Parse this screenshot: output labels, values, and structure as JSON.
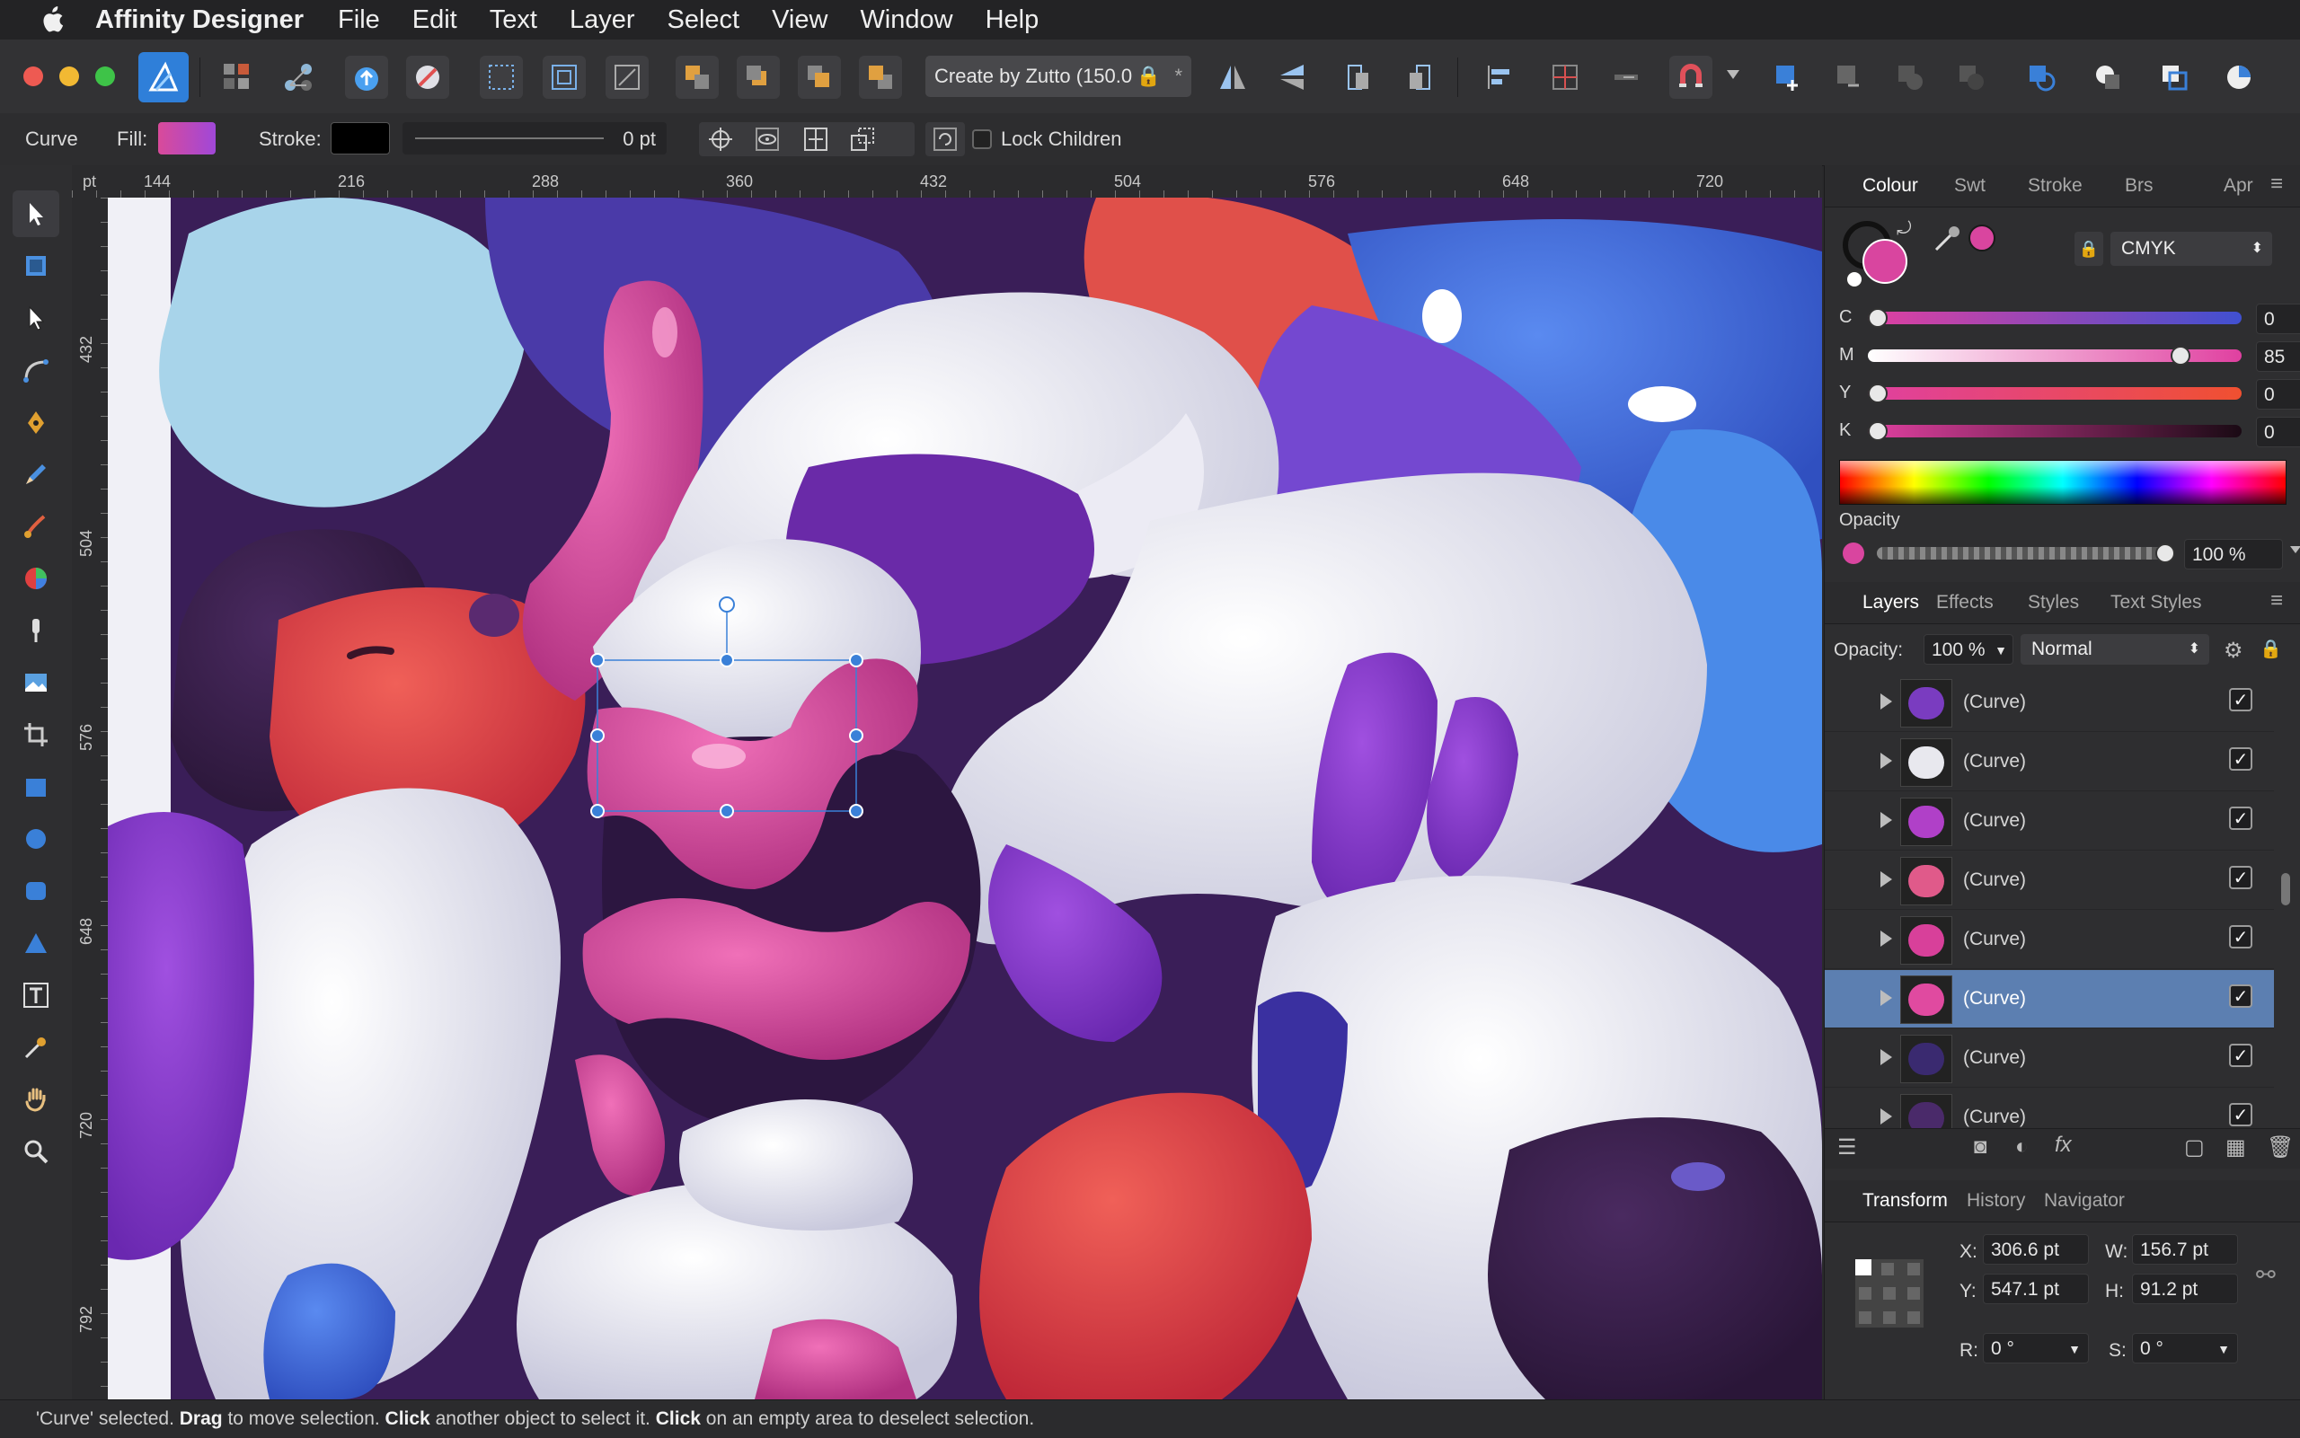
{
  "menubar": {
    "app_name": "Affinity Designer",
    "items": [
      "File",
      "Edit",
      "Text",
      "Layer",
      "Select",
      "View",
      "Window",
      "Help"
    ]
  },
  "toolbar": {
    "document_name": "Create by Zutto (150.0",
    "document_suffix": "*"
  },
  "context": {
    "object_type": "Curve",
    "fill_label": "Fill:",
    "stroke_label": "Stroke:",
    "stroke_width": "0 pt",
    "lock_children_label": "Lock Children"
  },
  "rulers": {
    "unit": "pt",
    "top_ticks": [
      "144",
      "216",
      "288",
      "360",
      "432",
      "504",
      "576",
      "648",
      "720"
    ],
    "left_ticks": [
      "432",
      "504",
      "576",
      "648",
      "720",
      "792"
    ]
  },
  "colour_panel": {
    "tabs": [
      "Colour",
      "Swt",
      "Stroke",
      "Brs",
      "Apr"
    ],
    "active_tab": "Colour",
    "mode": "CMYK",
    "channels": [
      {
        "label": "C",
        "value": "0",
        "level": 0
      },
      {
        "label": "M",
        "value": "85",
        "level": 0.85
      },
      {
        "label": "Y",
        "value": "0",
        "level": 0
      },
      {
        "label": "K",
        "value": "0",
        "level": 0
      }
    ],
    "opacity_label": "Opacity",
    "opacity_value": "100 %",
    "fill_color": "#d9459f"
  },
  "layers_panel": {
    "tabs": [
      "Layers",
      "Effects",
      "Styles",
      "Text Styles"
    ],
    "active_tab": "Layers",
    "opacity_label": "Opacity:",
    "opacity_value": "100 %",
    "blend_mode": "Normal",
    "rows": [
      {
        "name": "(Curve)",
        "selected": false,
        "visible": true,
        "thumb_color": "#7a3cc0"
      },
      {
        "name": "(Curve)",
        "selected": false,
        "visible": true,
        "thumb_color": "#e8e8ee"
      },
      {
        "name": "(Curve)",
        "selected": false,
        "visible": true,
        "thumb_color": "#b040c8"
      },
      {
        "name": "(Curve)",
        "selected": false,
        "visible": true,
        "thumb_color": "#e05a8a"
      },
      {
        "name": "(Curve)",
        "selected": false,
        "visible": true,
        "thumb_color": "#d8409a"
      },
      {
        "name": "(Curve)",
        "selected": true,
        "visible": true,
        "thumb_color": "#e04aa0"
      },
      {
        "name": "(Curve)",
        "selected": false,
        "visible": true,
        "thumb_color": "#3a2a70"
      },
      {
        "name": "(Curve)",
        "selected": false,
        "visible": true,
        "thumb_color": "#4a2a6a"
      }
    ]
  },
  "transform_panel": {
    "tabs": [
      "Transform",
      "History",
      "Navigator"
    ],
    "active_tab": "Transform",
    "x_label": "X:",
    "x": "306.6 pt",
    "y_label": "Y:",
    "y": "547.1 pt",
    "w_label": "W:",
    "w": "156.7 pt",
    "h_label": "H:",
    "h": "91.2 pt",
    "r_label": "R:",
    "r": "0 °",
    "s_label": "S:",
    "s": "0 °"
  },
  "status": {
    "part1": "'Curve' selected. ",
    "drag": "Drag",
    "part2": " to move selection. ",
    "click1": "Click",
    "part3": " another object to select it. ",
    "click2": "Click",
    "part4": " on an empty area to deselect selection."
  }
}
